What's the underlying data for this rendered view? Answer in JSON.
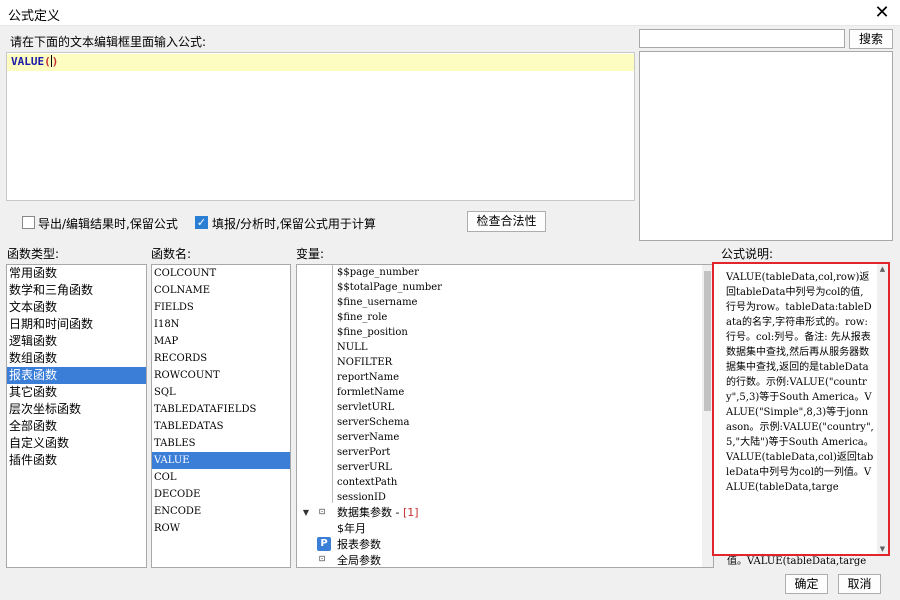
{
  "window": {
    "title": "公式定义",
    "close_glyph": "✕"
  },
  "editor": {
    "label": "请在下面的文本编辑框里面输入公式:",
    "func_name": "VALUE",
    "open_paren": "(",
    "close_paren": ")"
  },
  "search": {
    "placeholder": "",
    "button_label": "搜索"
  },
  "options": {
    "export_keep_formula": {
      "label": "导出/编辑结果时,保留公式",
      "checked": false
    },
    "fill_keep_formula": {
      "label": "填报/分析时,保留公式用于计算",
      "checked": true
    },
    "check_button": "检查合法性"
  },
  "function_types": {
    "label": "函数类型:",
    "items": [
      "常用函数",
      "数学和三角函数",
      "文本函数",
      "日期和时间函数",
      "逻辑函数",
      "数组函数",
      "报表函数",
      "其它函数",
      "层次坐标函数",
      "全部函数",
      "自定义函数",
      "插件函数"
    ],
    "selected_index": 6
  },
  "function_names": {
    "label": "函数名:",
    "items": [
      "COLCOUNT",
      "COLNAME",
      "FIELDS",
      "I18N",
      "MAP",
      "RECORDS",
      "ROWCOUNT",
      "SQL",
      "TABLEDATAFIELDS",
      "TABLEDATAS",
      "TABLES",
      "VALUE",
      "COL",
      "DECODE",
      "ENCODE",
      "ROW"
    ],
    "selected_index": 11
  },
  "variables": {
    "label": "变量:",
    "items": [
      "$$page_number",
      "$$totalPage_number",
      "$fine_username",
      "$fine_role",
      "$fine_position",
      "NULL",
      "NOFILTER",
      "reportName",
      "formletName",
      "servletURL",
      "serverSchema",
      "serverName",
      "serverPort",
      "serverURL",
      "contextPath",
      "sessionID"
    ],
    "dataset_group": {
      "label": "数据集参数",
      "suffix": " - ",
      "index": "[1]"
    },
    "dataset_child": "$年月",
    "report_params": "报表参数",
    "global_params": "全局参数"
  },
  "description": {
    "label": "公式说明:",
    "text": "VALUE(tableData,col,row)返回tableData中列号为col的值, 行号为row。tableData:tableData的名字,字符串形式的。row:行号。col:列号。备注: 先从报表数据集中查找,然后再从服务器数据集中查找,返回的是tableData的行数。示例:VALUE(\"country\",5,3)等于South America。VALUE(\"Simple\",8,3)等于jonnason。示例:VALUE(\"country\",5,\"大陆\")等于South America。VALUE(tableData,col)返回tableData中列号为col的一列值。VALUE(tableData,targe",
    "tail": "值。VALUE(tableData,targe"
  },
  "footer": {
    "ok_label": "确定",
    "cancel_label": "取消"
  },
  "colors": {
    "highlight_border": "#e0262b",
    "selection": "#3b7ed8",
    "editor_line": "#fdfdc2"
  }
}
